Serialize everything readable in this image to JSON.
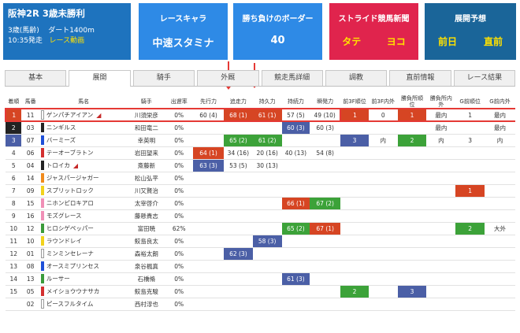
{
  "race": {
    "title": "阪神2R 3歳未勝利",
    "cls": "3歳(馬齢)",
    "track": "ダート1400m",
    "time": "10:35発走",
    "video": "レース動画"
  },
  "chara": {
    "header": "レースキャラ",
    "value": "中速スタミナ"
  },
  "border": {
    "header": "勝ち負けのボーダー",
    "value": "40"
  },
  "stride": {
    "header": "ストライド競馬新聞",
    "a": "タテ",
    "b": "ヨコ"
  },
  "tenkai": {
    "header": "展開予想",
    "a": "前日",
    "b": "直前"
  },
  "tabs": [
    "基本",
    "展開",
    "騎手",
    "外厩",
    "競走馬詳細",
    "調教",
    "直前情報",
    "レース結果"
  ],
  "active_tab": 1,
  "columns": [
    "着順",
    "馬番",
    "馬名",
    "騎手",
    "出遅率",
    "先行力",
    "追走力",
    "持久力",
    "持続力",
    "瞬発力",
    "前3F順位",
    "前3F内外",
    "勝負所順位",
    "勝負所内外",
    "G前順位",
    "G前内外"
  ],
  "colors": {
    "frame1": "#ffffff",
    "frame2": "#222222",
    "frame3": "#d32f2f",
    "frame4": "#1e4fd8",
    "frame5": "#f2d21b",
    "frame6": "#3a9b3a",
    "frame7": "#f08a1c",
    "frame8": "#f08fb6",
    "red": "#d64523",
    "green": "#3ca239",
    "blue": "#4b5fa6",
    "highlight": "#e53935"
  },
  "rows": [
    {
      "rank": "1",
      "frame": 1,
      "num": "11",
      "name": "ゲンパチアイアン",
      "mark": true,
      "jockey": "川須栄彦",
      "late": "0%",
      "lead": "60 (4)",
      "chase": "68 (1)",
      "stamina": "61 (1)",
      "sustain": "57 (5)",
      "burst": "49 (10)",
      "f3r": "1",
      "f3i": "0",
      "sr": "1",
      "si": "最内",
      "gr": "1",
      "gi": "最内",
      "c": {
        "chase": "red",
        "stamina": "red",
        "f3r": "red",
        "sr": "red"
      },
      "fc": "#fff"
    },
    {
      "rank": "2",
      "frame": 2,
      "num": "03",
      "name": "ニンギルス",
      "mark": false,
      "jockey": "和田竜二",
      "late": "0%",
      "lead": "",
      "chase": "",
      "stamina": "",
      "sustain": "60 (3)",
      "burst": "60 (3)",
      "f3r": "",
      "f3i": "",
      "sr": "",
      "si": "最内",
      "gr": "",
      "gi": "最内",
      "c": {
        "sustain": "blue"
      }
    },
    {
      "rank": "3",
      "frame": 4,
      "num": "07",
      "name": "バーミーズ",
      "mark": false,
      "jockey": "幸英明",
      "late": "0%",
      "lead": "",
      "chase": "65 (2)",
      "stamina": "61 (2)",
      "sustain": "",
      "burst": "",
      "f3r": "3",
      "f3i": "内",
      "sr": "2",
      "si": "内",
      "gr": "3",
      "gi": "内",
      "c": {
        "chase": "green",
        "stamina": "green",
        "f3r": "blue",
        "sr": "green"
      }
    },
    {
      "rank": "4",
      "frame": 3,
      "num": "06",
      "name": "テーオーブラトン",
      "mark": false,
      "jockey": "岩田望来",
      "late": "0%",
      "lead": "64 (1)",
      "chase": "34 (16)",
      "stamina": "20 (16)",
      "sustain": "40 (13)",
      "burst": "54 (8)",
      "f3r": "",
      "f3i": "",
      "sr": "",
      "si": "",
      "gr": "",
      "gi": "",
      "c": {
        "lead": "red"
      }
    },
    {
      "rank": "5",
      "frame": 2,
      "num": "04",
      "name": "トロイカ",
      "mark": true,
      "jockey": "斎藤新",
      "late": "0%",
      "lead": "63 (3)",
      "chase": "53 (5)",
      "stamina": "30 (13)",
      "sustain": "",
      "burst": "",
      "f3r": "",
      "f3i": "",
      "sr": "",
      "si": "",
      "gr": "",
      "gi": "",
      "c": {
        "lead": "blue"
      }
    },
    {
      "rank": "6",
      "frame": 7,
      "num": "14",
      "name": "ジャスパージャガー",
      "mark": false,
      "jockey": "松山弘平",
      "late": "0%",
      "lead": "",
      "chase": "",
      "stamina": "",
      "sustain": "",
      "burst": "",
      "f3r": "",
      "f3i": "",
      "sr": "",
      "si": "",
      "gr": "",
      "gi": "",
      "c": {}
    },
    {
      "rank": "7",
      "frame": 5,
      "num": "09",
      "name": "スプリットロック",
      "mark": false,
      "jockey": "川又賢治",
      "late": "0%",
      "lead": "",
      "chase": "",
      "stamina": "",
      "sustain": "",
      "burst": "",
      "f3r": "",
      "f3i": "",
      "sr": "",
      "si": "",
      "gr": "1",
      "gi": "",
      "c": {
        "gr": "red"
      }
    },
    {
      "rank": "8",
      "frame": 8,
      "num": "15",
      "name": "ニホンピロキアロ",
      "mark": false,
      "jockey": "太宰啓介",
      "late": "0%",
      "lead": "",
      "chase": "",
      "stamina": "",
      "sustain": "66 (1)",
      "burst": "67 (2)",
      "f3r": "",
      "f3i": "",
      "sr": "",
      "si": "",
      "gr": "",
      "gi": "",
      "c": {
        "sustain": "red",
        "burst": "green"
      }
    },
    {
      "rank": "9",
      "frame": 8,
      "num": "16",
      "name": "モズグレース",
      "mark": false,
      "jockey": "藤懸貴志",
      "late": "0%",
      "lead": "",
      "chase": "",
      "stamina": "",
      "sustain": "",
      "burst": "",
      "f3r": "",
      "f3i": "",
      "sr": "",
      "si": "",
      "gr": "",
      "gi": "",
      "c": {}
    },
    {
      "rank": "10",
      "frame": 6,
      "num": "12",
      "name": "ヒロシゲペッパー",
      "mark": false,
      "jockey": "富田暁",
      "late": "62%",
      "lead": "",
      "chase": "",
      "stamina": "",
      "sustain": "65 (2)",
      "burst": "67 (1)",
      "f3r": "",
      "f3i": "",
      "sr": "",
      "si": "",
      "gr": "2",
      "gi": "大外",
      "c": {
        "sustain": "green",
        "burst": "red",
        "gr": "green"
      }
    },
    {
      "rank": "11",
      "frame": 5,
      "num": "10",
      "name": "ラウンドレイ",
      "mark": false,
      "jockey": "鮫島良太",
      "late": "0%",
      "lead": "",
      "chase": "",
      "stamina": "58 (3)",
      "sustain": "",
      "burst": "",
      "f3r": "",
      "f3i": "",
      "sr": "",
      "si": "",
      "gr": "",
      "gi": "",
      "c": {
        "stamina": "blue"
      }
    },
    {
      "rank": "12",
      "frame": 1,
      "num": "01",
      "name": "ミンミンセレーナ",
      "mark": false,
      "jockey": "森裕太朗",
      "late": "0%",
      "lead": "",
      "chase": "62 (3)",
      "stamina": "",
      "sustain": "",
      "burst": "",
      "f3r": "",
      "f3i": "",
      "sr": "",
      "si": "",
      "gr": "",
      "gi": "",
      "c": {
        "chase": "blue"
      }
    },
    {
      "rank": "13",
      "frame": 4,
      "num": "08",
      "name": "オースミプリンセス",
      "mark": false,
      "jockey": "泉谷楓真",
      "late": "0%",
      "lead": "",
      "chase": "",
      "stamina": "",
      "sustain": "",
      "burst": "",
      "f3r": "",
      "f3i": "",
      "sr": "",
      "si": "",
      "gr": "",
      "gi": "",
      "c": {}
    },
    {
      "rank": "14",
      "frame": 6,
      "num": "13",
      "name": "ルーサー",
      "mark": false,
      "jockey": "石橋脩",
      "late": "0%",
      "lead": "",
      "chase": "",
      "stamina": "",
      "sustain": "61 (3)",
      "burst": "",
      "f3r": "",
      "f3i": "",
      "sr": "",
      "si": "",
      "gr": "",
      "gi": "",
      "c": {
        "sustain": "blue"
      }
    },
    {
      "rank": "15",
      "frame": 3,
      "num": "05",
      "name": "メイショウウナサカ",
      "mark": false,
      "jockey": "鮫島克駿",
      "late": "0%",
      "lead": "",
      "chase": "",
      "stamina": "",
      "sustain": "",
      "burst": "",
      "f3r": "2",
      "f3i": "",
      "sr": "3",
      "si": "",
      "gr": "",
      "gi": "",
      "c": {
        "f3r": "green",
        "sr": "blue"
      }
    },
    {
      "rank": "",
      "frame": 1,
      "num": "02",
      "name": "ピースフルタイム",
      "mark": false,
      "jockey": "西村淳也",
      "late": "0%",
      "lead": "",
      "chase": "",
      "stamina": "",
      "sustain": "",
      "burst": "",
      "f3r": "",
      "f3i": "",
      "sr": "",
      "si": "",
      "gr": "",
      "gi": "",
      "c": {}
    }
  ],
  "filler": [
    {
      "lead": "",
      "chase": "",
      "stamina": ""
    }
  ],
  "extra": {
    "r2": {
      "lead": "",
      "chase": "",
      "stamina": "",
      "burst": "60 (3)"
    },
    "values": {
      "r2": [
        "",
        "",
        "",
        "60 (3)",
        "60 (3)",
        "",
        "",
        "",
        "最内",
        "",
        "最内"
      ],
      "r3": [
        "",
        "65 (2)",
        "61 (2)",
        "",
        "",
        "3",
        "内",
        "2",
        "内",
        "3",
        "内"
      ]
    }
  }
}
